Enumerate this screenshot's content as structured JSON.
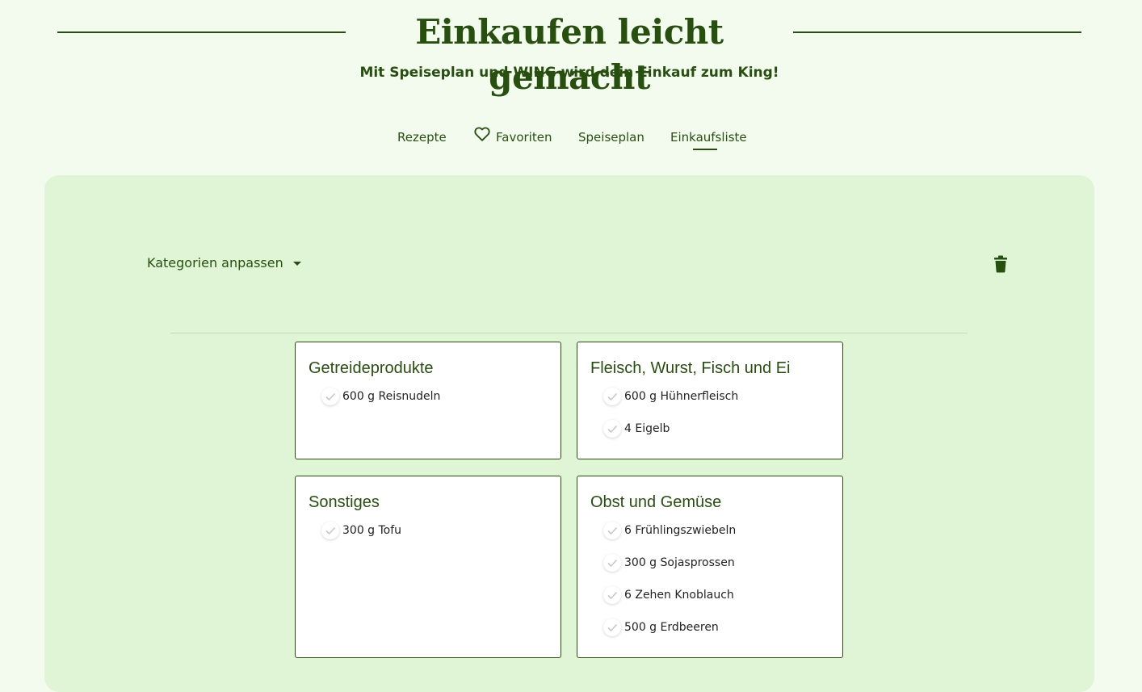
{
  "header": {
    "title": "Einkaufen leicht gemacht",
    "subtitle": "Mit Speiseplan und WING wird dein Einkauf zum King!"
  },
  "nav": {
    "items": [
      {
        "label": "Rezepte",
        "icon": ""
      },
      {
        "label": "Favoriten",
        "icon": "heart-icon"
      },
      {
        "label": "Speiseplan",
        "icon": ""
      },
      {
        "label": "Einkaufsliste",
        "icon": "",
        "active": true
      }
    ]
  },
  "toolbar": {
    "categories_label": "Kategorien anpassen",
    "delete_icon": "trash-icon"
  },
  "categories": [
    {
      "title": "Getreideprodukte",
      "items": [
        "600 g Reisnudeln"
      ]
    },
    {
      "title": "Fleisch, Wurst, Fisch und Ei",
      "items": [
        "600 g Hühnerfleisch",
        "4 Eigelb"
      ]
    },
    {
      "title": "Sonstiges",
      "items": [
        "300 g Tofu"
      ]
    },
    {
      "title": "Obst und Gemüse",
      "items": [
        "6 Frühlingszwiebeln",
        "300 g Sojasprossen",
        "6 Zehen Knoblauch",
        "500 g Erdbeeren"
      ]
    }
  ],
  "colors": {
    "accent": "#27500f",
    "background": "#f3fbef",
    "panel": "#dff5d6"
  }
}
